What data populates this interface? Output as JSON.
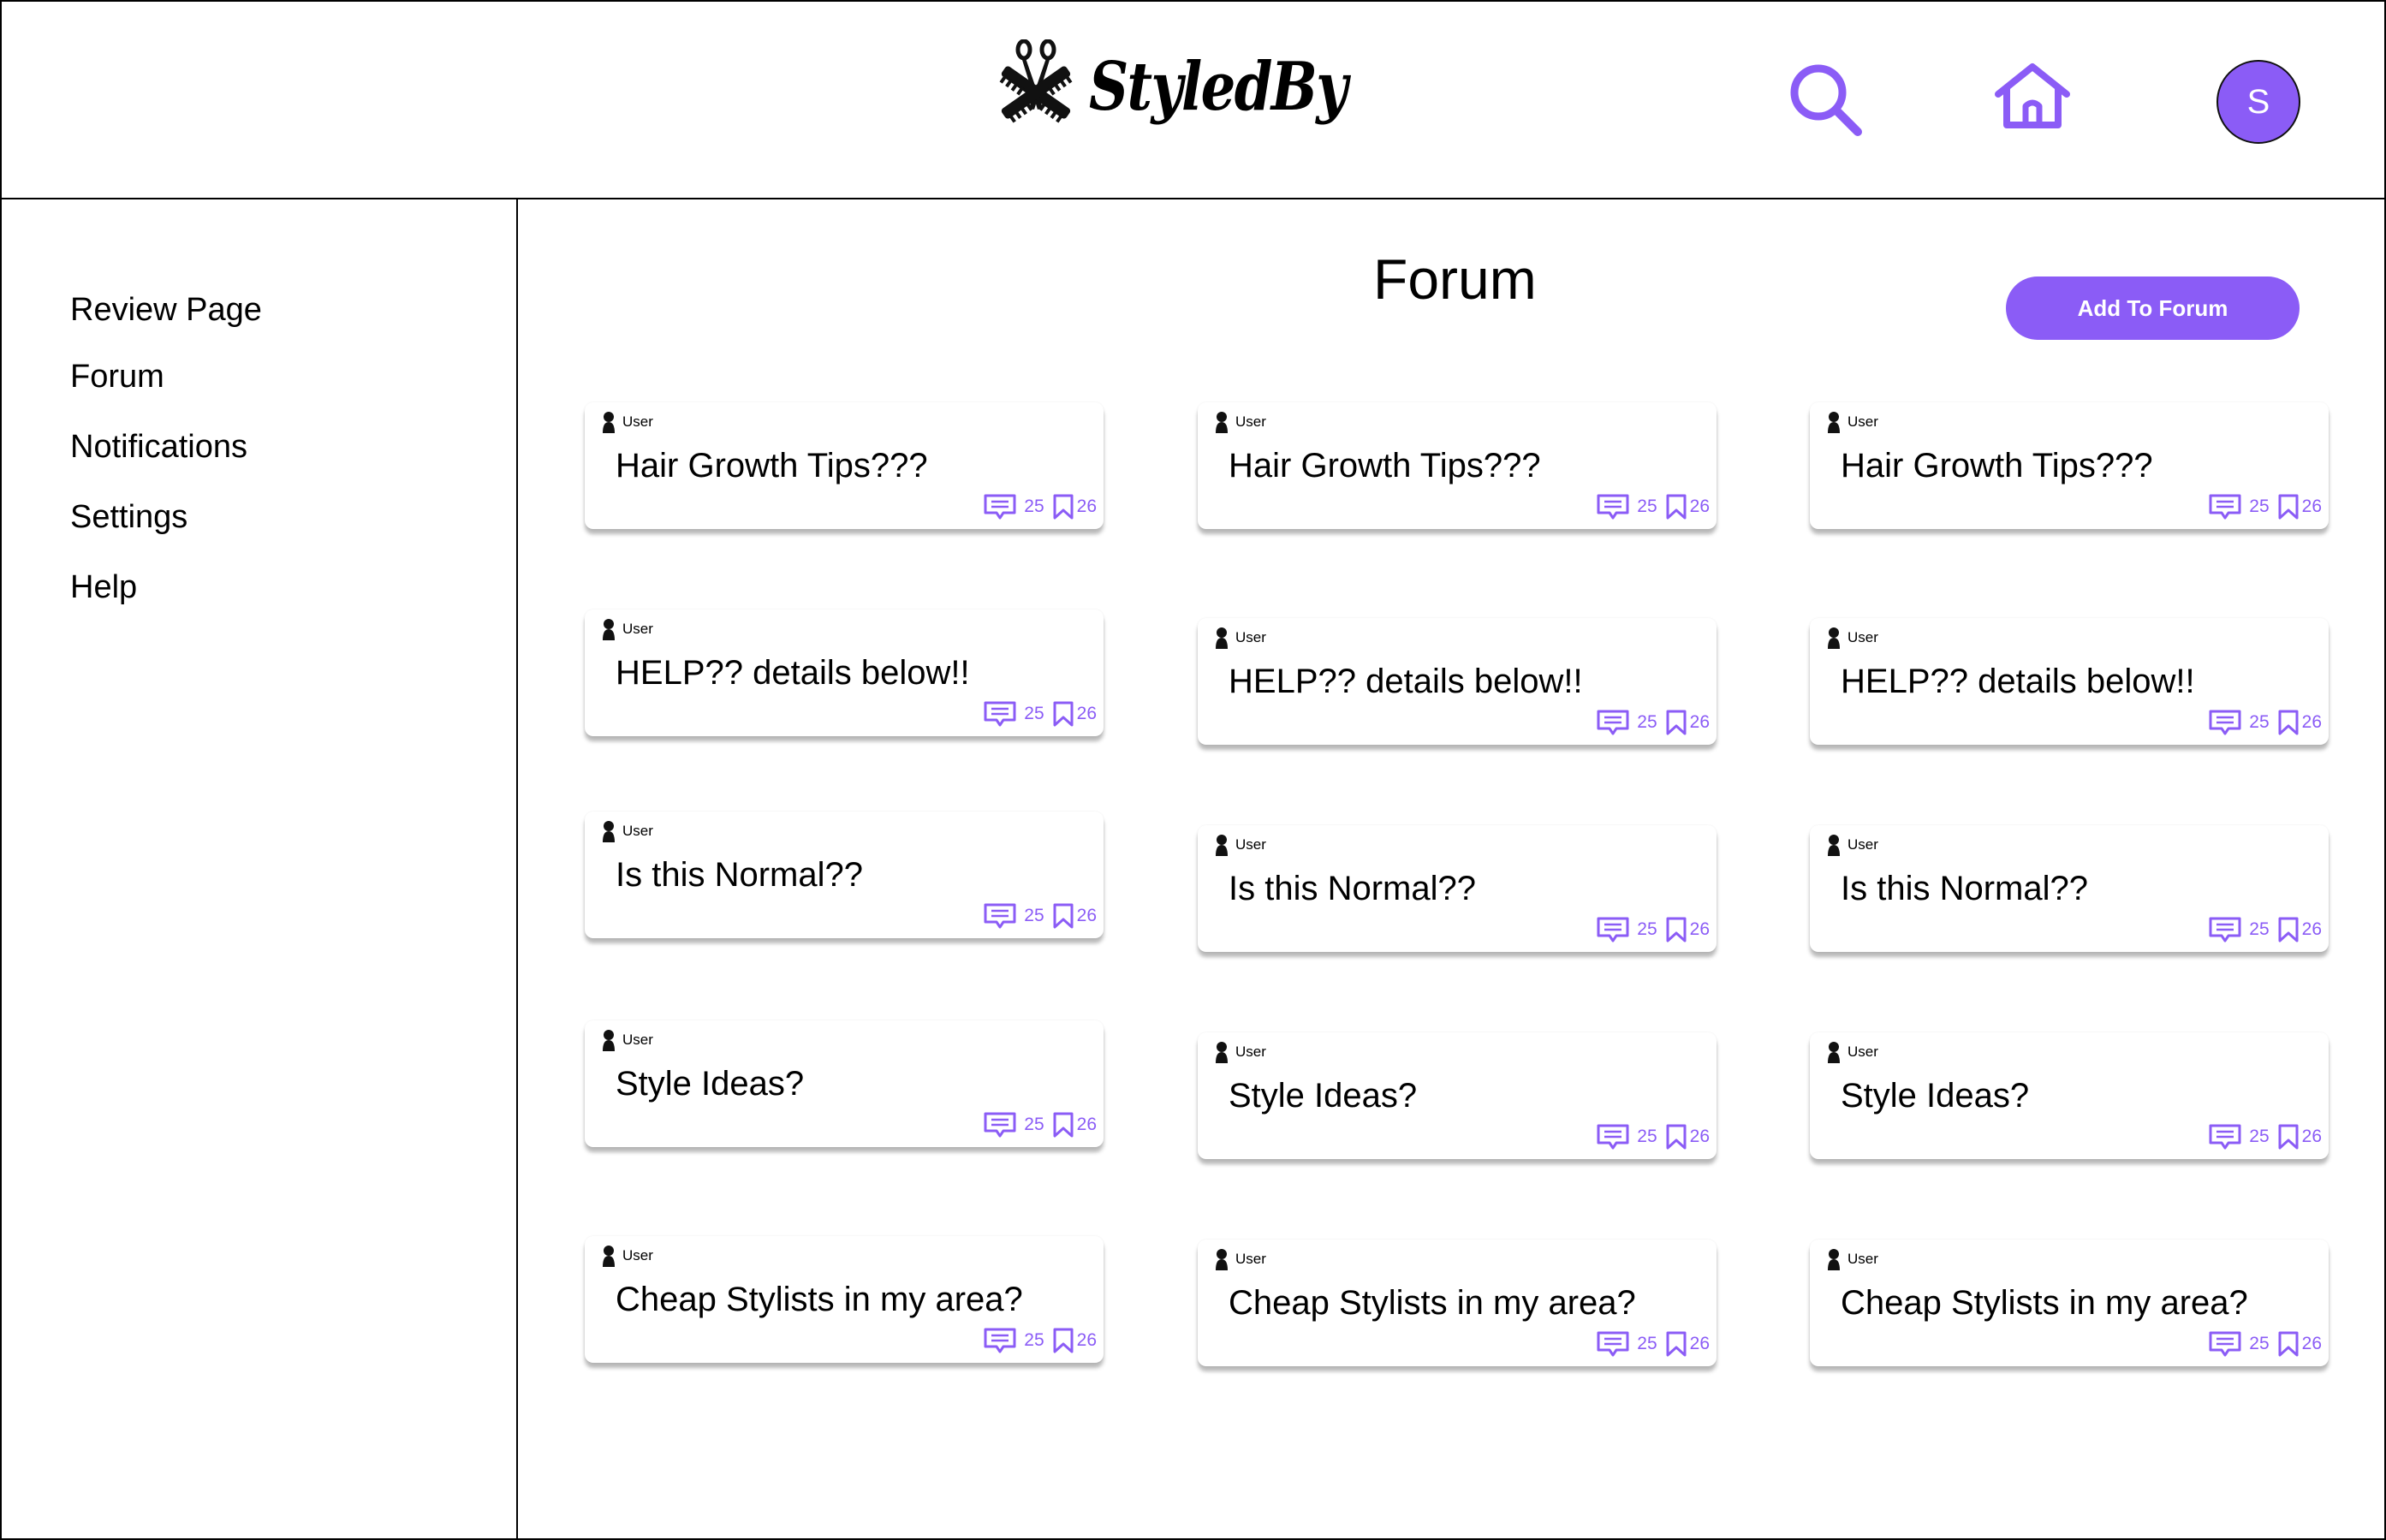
{
  "header": {
    "brand": "StyledBy",
    "avatar_initial": "S",
    "accent_color": "#8b5cf6"
  },
  "sidebar": {
    "items": [
      {
        "label": "Review Page"
      },
      {
        "label": "Forum"
      },
      {
        "label": "Notifications"
      },
      {
        "label": "Settings"
      },
      {
        "label": "Help"
      }
    ]
  },
  "main": {
    "title": "Forum",
    "add_button": "Add To Forum",
    "posts": [
      {
        "user": "User",
        "title": "Hair Growth Tips???",
        "comments": "25",
        "saves": "26"
      },
      {
        "user": "User",
        "title": "Hair Growth Tips???",
        "comments": "25",
        "saves": "26"
      },
      {
        "user": "User",
        "title": "Hair Growth Tips???",
        "comments": "25",
        "saves": "26"
      },
      {
        "user": "User",
        "title": "HELP?? details below!!",
        "comments": "25",
        "saves": "26"
      },
      {
        "user": "User",
        "title": "HELP?? details below!!",
        "comments": "25",
        "saves": "26"
      },
      {
        "user": "User",
        "title": "HELP?? details below!!",
        "comments": "25",
        "saves": "26"
      },
      {
        "user": "User",
        "title": "Is this Normal??",
        "comments": "25",
        "saves": "26"
      },
      {
        "user": "User",
        "title": "Is this Normal??",
        "comments": "25",
        "saves": "26"
      },
      {
        "user": "User",
        "title": "Is this Normal??",
        "comments": "25",
        "saves": "26"
      },
      {
        "user": "User",
        "title": "Style Ideas?",
        "comments": "25",
        "saves": "26"
      },
      {
        "user": "User",
        "title": "Style Ideas?",
        "comments": "25",
        "saves": "26"
      },
      {
        "user": "User",
        "title": "Style Ideas?",
        "comments": "25",
        "saves": "26"
      },
      {
        "user": "User",
        "title": "Cheap Stylists in my area?",
        "comments": "25",
        "saves": "26"
      },
      {
        "user": "User",
        "title": "Cheap Stylists in my area?",
        "comments": "25",
        "saves": "26"
      },
      {
        "user": "User",
        "title": "Cheap Stylists in my area?",
        "comments": "25",
        "saves": "26"
      }
    ]
  }
}
